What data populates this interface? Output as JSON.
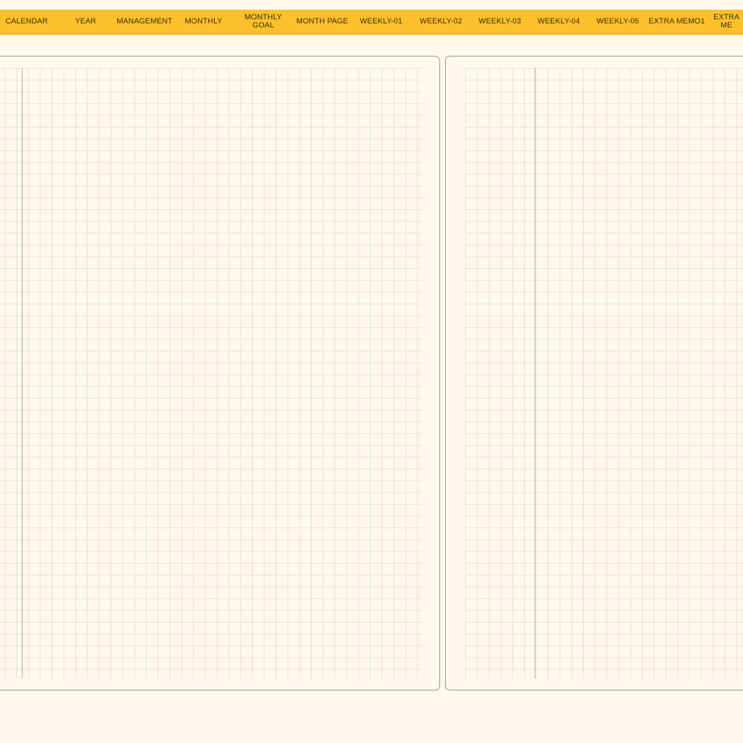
{
  "nav": {
    "tabs": [
      {
        "label": "CALENDAR"
      },
      {
        "label": "YEAR"
      },
      {
        "label": "MANAGEMENT"
      },
      {
        "label": "MONTHLY"
      },
      {
        "label": "MONTHLY\nGOAL"
      },
      {
        "label": "MONTH PAGE"
      },
      {
        "label": "WEEKLY-01"
      },
      {
        "label": "WEEKLY-02"
      },
      {
        "label": "WEEKLY-03"
      },
      {
        "label": "WEEKLY-04"
      },
      {
        "label": "WEEKLY-05"
      },
      {
        "label": "EXTRA MEMO1"
      },
      {
        "label": "EXTRA ME"
      }
    ]
  },
  "colors": {
    "tab_bar": "#fcc02b",
    "paper": "#fff8ec",
    "page_border": "#a8a198",
    "grid_line": "#e6e1d6"
  }
}
